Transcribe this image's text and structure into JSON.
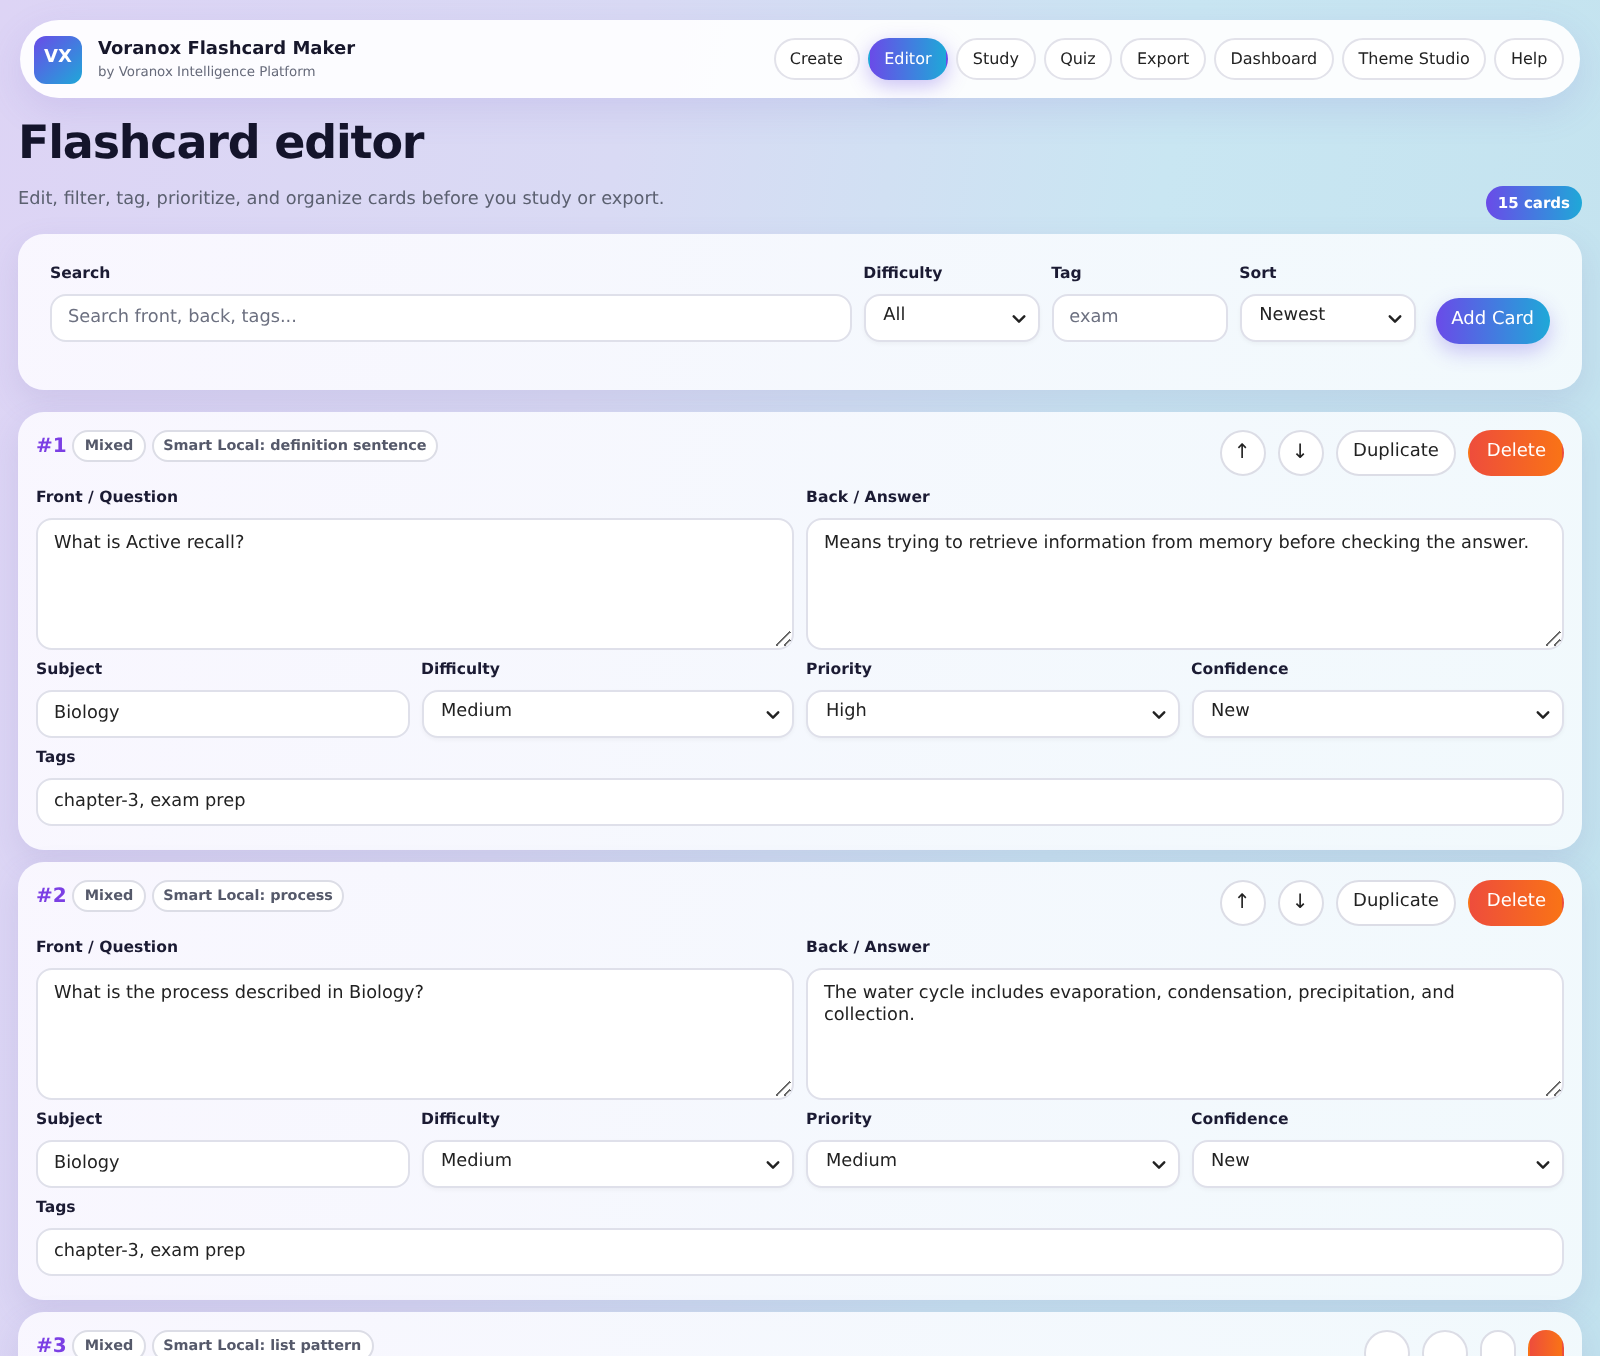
{
  "app": {
    "logo": "VX",
    "title": "Voranox Flashcard Maker",
    "subtitle": "by Voranox Intelligence Platform"
  },
  "nav": [
    {
      "label": "Create",
      "selected": false
    },
    {
      "label": "Editor",
      "selected": true
    },
    {
      "label": "Study",
      "selected": false
    },
    {
      "label": "Quiz",
      "selected": false
    },
    {
      "label": "Export",
      "selected": false
    },
    {
      "label": "Dashboard",
      "selected": false
    },
    {
      "label": "Theme Studio",
      "selected": false
    },
    {
      "label": "Help",
      "selected": false
    }
  ],
  "page": {
    "title": "Flashcard editor",
    "description": "Edit, filter, tag, prioritize, and organize cards before you study or export.",
    "count_badge": "15 cards"
  },
  "filters": [
    {
      "label": "Search",
      "kind": "input",
      "placeholder": "Search front, back, tags..."
    },
    {
      "label": "Difficulty",
      "kind": "select",
      "value": "All"
    },
    {
      "label": "Tag",
      "kind": "input",
      "placeholder": "exam"
    },
    {
      "label": "Sort",
      "kind": "select",
      "value": "Newest"
    }
  ],
  "add_button": "Add Card",
  "cards": [
    {
      "number": "#1",
      "badges": [
        "Mixed",
        "Smart Local: definition sentence"
      ],
      "actions": [
        {
          "kind": "up",
          "label": "↑"
        },
        {
          "kind": "down",
          "label": "↓"
        },
        {
          "kind": "duplicate",
          "label": "Duplicate"
        },
        {
          "kind": "delete",
          "label": "Delete"
        }
      ],
      "text_fields": [
        {
          "label": "Front / Question",
          "kind": "textarea",
          "value": "What is Active recall?"
        },
        {
          "label": "Back / Answer",
          "kind": "textarea",
          "value": "Means trying to retrieve information from memory before checking the answer."
        }
      ],
      "meta_fields": [
        {
          "label": "Subject",
          "kind": "input",
          "value": "Biology"
        },
        {
          "label": "Difficulty",
          "kind": "select",
          "value": "Medium"
        },
        {
          "label": "Priority",
          "kind": "select",
          "value": "High"
        },
        {
          "label": "Confidence",
          "kind": "select",
          "value": "New"
        }
      ],
      "tags": {
        "label": "Tags",
        "kind": "input",
        "value": "chapter-3, exam prep"
      }
    },
    {
      "number": "#2",
      "badges": [
        "Mixed",
        "Smart Local: process"
      ],
      "actions": [
        {
          "kind": "up",
          "label": "↑"
        },
        {
          "kind": "down",
          "label": "↓"
        },
        {
          "kind": "duplicate",
          "label": "Duplicate"
        },
        {
          "kind": "delete",
          "label": "Delete"
        }
      ],
      "text_fields": [
        {
          "label": "Front / Question",
          "kind": "textarea",
          "value": "What is the process described in Biology?"
        },
        {
          "label": "Back / Answer",
          "kind": "textarea",
          "value": "The water cycle includes evaporation, condensation, precipitation, and collection."
        }
      ],
      "meta_fields": [
        {
          "label": "Subject",
          "kind": "input",
          "value": "Biology"
        },
        {
          "label": "Difficulty",
          "kind": "select",
          "value": "Medium"
        },
        {
          "label": "Priority",
          "kind": "select",
          "value": "Medium"
        },
        {
          "label": "Confidence",
          "kind": "select",
          "value": "New"
        }
      ],
      "tags": {
        "label": "Tags",
        "kind": "input",
        "value": "chapter-3, exam prep"
      }
    },
    {
      "number": "#3",
      "badges": [
        "Mixed",
        "Smart Local: list pattern"
      ],
      "actions": [
        {
          "kind": "up"
        },
        {
          "kind": "down"
        },
        {
          "kind": "duplicate"
        },
        {
          "kind": "delete"
        }
      ]
    }
  ]
}
